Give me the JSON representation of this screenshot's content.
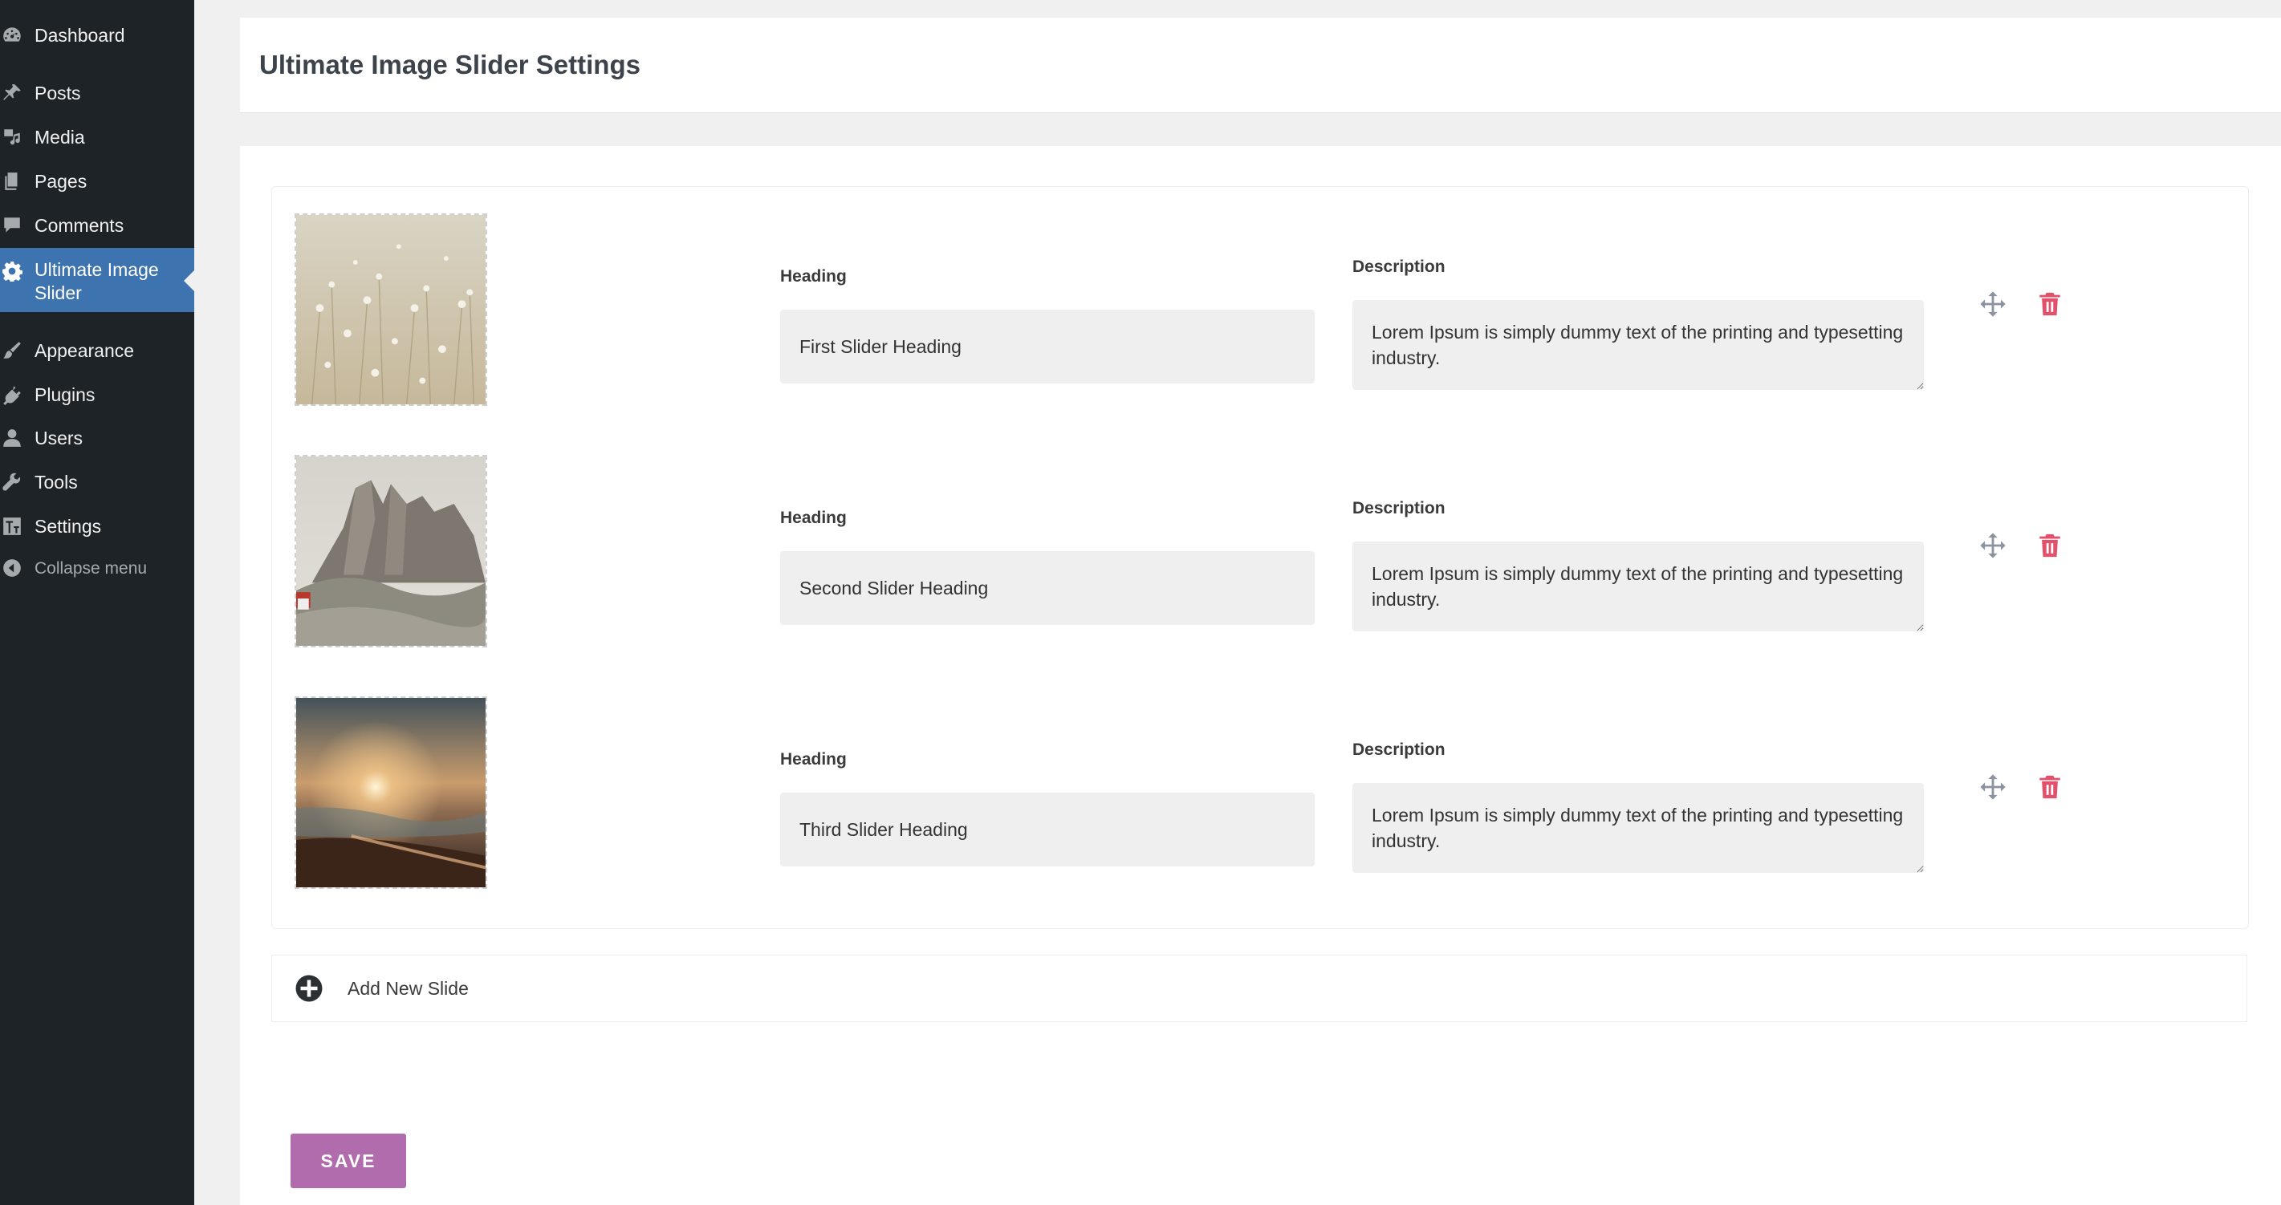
{
  "sidebar": {
    "items": [
      {
        "label": "Dashboard",
        "icon": "dashboard-icon"
      },
      {
        "label": "Posts",
        "icon": "pin-icon"
      },
      {
        "label": "Media",
        "icon": "media-icon"
      },
      {
        "label": "Pages",
        "icon": "pages-icon"
      },
      {
        "label": "Comments",
        "icon": "comment-icon"
      },
      {
        "label": "Ultimate Image Slider",
        "icon": "gear-icon",
        "current": true
      },
      {
        "label": "Appearance",
        "icon": "brush-icon"
      },
      {
        "label": "Plugins",
        "icon": "plug-icon"
      },
      {
        "label": "Users",
        "icon": "user-icon"
      },
      {
        "label": "Tools",
        "icon": "wrench-icon"
      },
      {
        "label": "Settings",
        "icon": "settings-icon"
      }
    ],
    "collapse_label": "Collapse menu"
  },
  "header": {
    "title": "Ultimate Image Slider Settings"
  },
  "slides": [
    {
      "image": "field-of-white-flowers",
      "heading_label": "Heading",
      "heading_value": "First Slider Heading",
      "description_label": "Description",
      "description_value": "Lorem Ipsum is simply dummy text of the printing and typesetting industry."
    },
    {
      "image": "mountain-peaks",
      "heading_label": "Heading",
      "heading_value": "Second Slider Heading",
      "description_label": "Description",
      "description_value": "Lorem Ipsum is simply dummy text of the printing and typesetting industry."
    },
    {
      "image": "sunset-over-sea",
      "heading_label": "Heading",
      "heading_value": "Third Slider Heading",
      "description_label": "Description",
      "description_value": "Lorem Ipsum is simply dummy text of the printing and typesetting industry."
    }
  ],
  "add_slide_label": "Add New Slide",
  "save_label": "SAVE",
  "colors": {
    "sidebar_bg": "#1d2327",
    "sidebar_current": "#3d73ae",
    "save_button": "#b16cad",
    "delete_icon": "#e2506b",
    "move_icon": "#8c93a0"
  }
}
